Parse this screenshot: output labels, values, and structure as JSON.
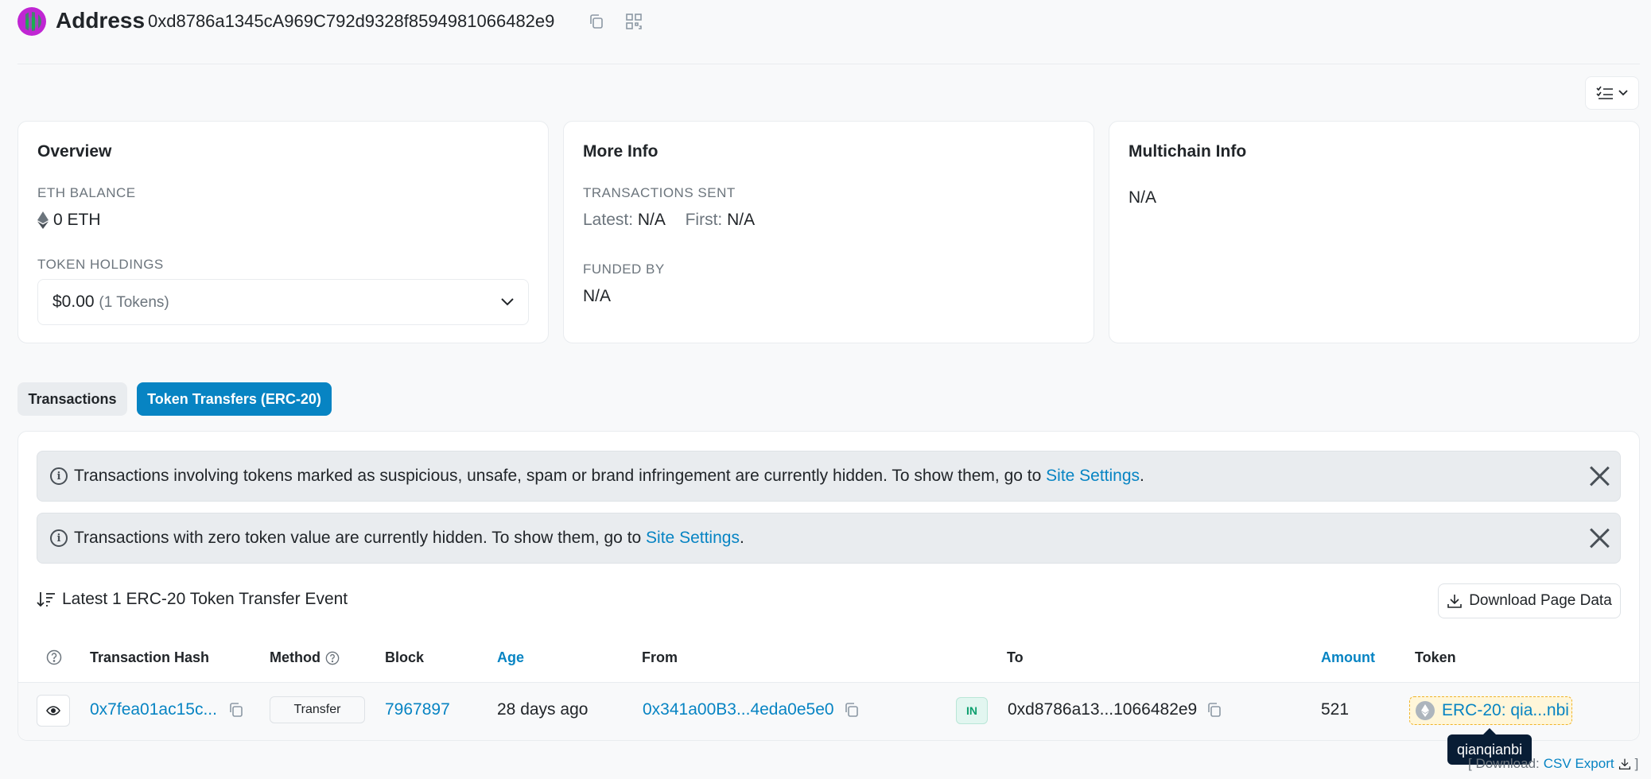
{
  "header": {
    "title": "Address",
    "address": "0xd8786a1345cA969C792d9328f8594981066482e9"
  },
  "overview": {
    "title": "Overview",
    "eth_balance_label": "ETH BALANCE",
    "eth_balance": "0 ETH",
    "token_holdings_label": "TOKEN HOLDINGS",
    "token_value": "$0.00",
    "token_count": "(1 Tokens)"
  },
  "more_info": {
    "title": "More Info",
    "tx_sent_label": "TRANSACTIONS SENT",
    "latest_label": "Latest:",
    "latest_value": "N/A",
    "first_label": "First:",
    "first_value": "N/A",
    "funded_by_label": "FUNDED BY",
    "funded_by_value": "N/A"
  },
  "multichain": {
    "title": "Multichain Info",
    "value": "N/A"
  },
  "tabs": [
    {
      "label": "Transactions"
    },
    {
      "label": "Token Transfers (ERC-20)"
    }
  ],
  "alerts": [
    {
      "text": "Transactions involving tokens marked as suspicious, unsafe, spam or brand infringement are currently hidden. To show them, go to ",
      "link": "Site Settings",
      "suffix": "."
    },
    {
      "text": "Transactions with zero token value are currently hidden. To show them, go to ",
      "link": "Site Settings",
      "suffix": "."
    }
  ],
  "summary": "Latest 1 ERC-20 Token Transfer Event",
  "download_label": "Download Page Data",
  "columns": {
    "hash": "Transaction Hash",
    "method": "Method",
    "block": "Block",
    "age": "Age",
    "from": "From",
    "to": "To",
    "amount": "Amount",
    "token": "Token"
  },
  "rows": [
    {
      "hash": "0x7fea01ac15c...",
      "method": "Transfer",
      "block": "7967897",
      "age": "28 days ago",
      "from": "0x341a00B3...4eda0e5e0",
      "direction": "IN",
      "to": "0xd8786a13...1066482e9",
      "amount": "521",
      "token": "ERC-20: qia...nbi"
    }
  ],
  "tooltip": "qianqianbi",
  "csv": {
    "prefix": "[ Download:",
    "link": "CSV Export",
    "suffix": "]"
  },
  "colors": {
    "accent": "#0784c3",
    "in_badge": "#0d9f6e",
    "token_highlight": "#fff6d9"
  }
}
